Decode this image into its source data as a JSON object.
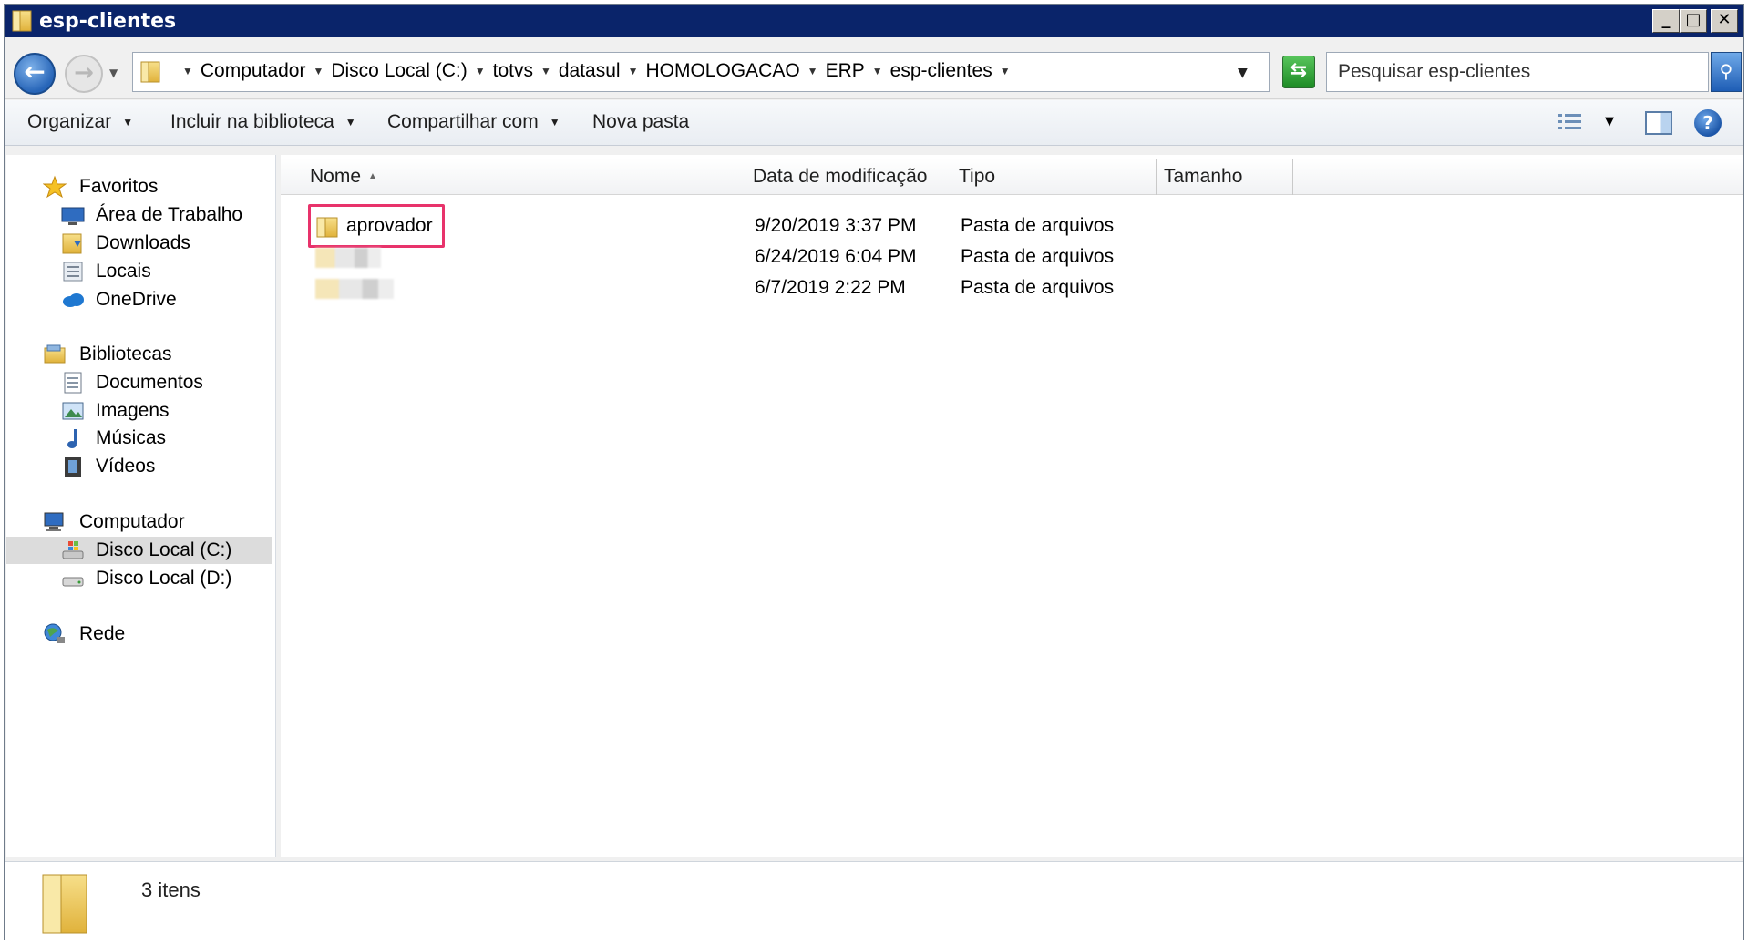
{
  "window": {
    "title": "esp-clientes",
    "controls": {
      "minimize": "0",
      "maximize": "1",
      "close": "r"
    }
  },
  "address_bar": {
    "crumbs": [
      "Computador",
      "Disco Local (C:)",
      "totvs",
      "datasul",
      "HOMOLOGACAO",
      "ERP",
      "esp-clientes"
    ],
    "search_placeholder": "Pesquisar esp-clientes"
  },
  "command_bar": {
    "organizar": "Organizar",
    "incluir": "Incluir na biblioteca",
    "compartilhar": "Compartilhar com",
    "nova_pasta": "Nova pasta"
  },
  "nav_pane": {
    "favoritos": "Favoritos",
    "area_trabalho": "Área de Trabalho",
    "downloads": "Downloads",
    "locais": "Locais",
    "onedrive": "OneDrive",
    "bibliotecas": "Bibliotecas",
    "documentos": "Documentos",
    "imagens": "Imagens",
    "musicas": "Músicas",
    "videos": "Vídeos",
    "computador": "Computador",
    "disco_c": "Disco Local (C:)",
    "disco_d": "Disco Local (D:)",
    "rede": "Rede"
  },
  "columns": {
    "nome": "Nome",
    "data": "Data de modificação",
    "tipo": "Tipo",
    "tamanho": "Tamanho"
  },
  "files": [
    {
      "name": "aprovador",
      "date": "9/20/2019 3:37 PM",
      "type": "Pasta de arquivos"
    },
    {
      "name": "",
      "date": "6/24/2019 6:04 PM",
      "type": "Pasta de arquivos"
    },
    {
      "name": "",
      "date": "6/7/2019 2:22 PM",
      "type": "Pasta de arquivos"
    }
  ],
  "status": {
    "count": "3 itens"
  },
  "colors": {
    "titlebar": "#0a246a",
    "highlight": "#e8336b",
    "folder": "#f2cc5b"
  }
}
